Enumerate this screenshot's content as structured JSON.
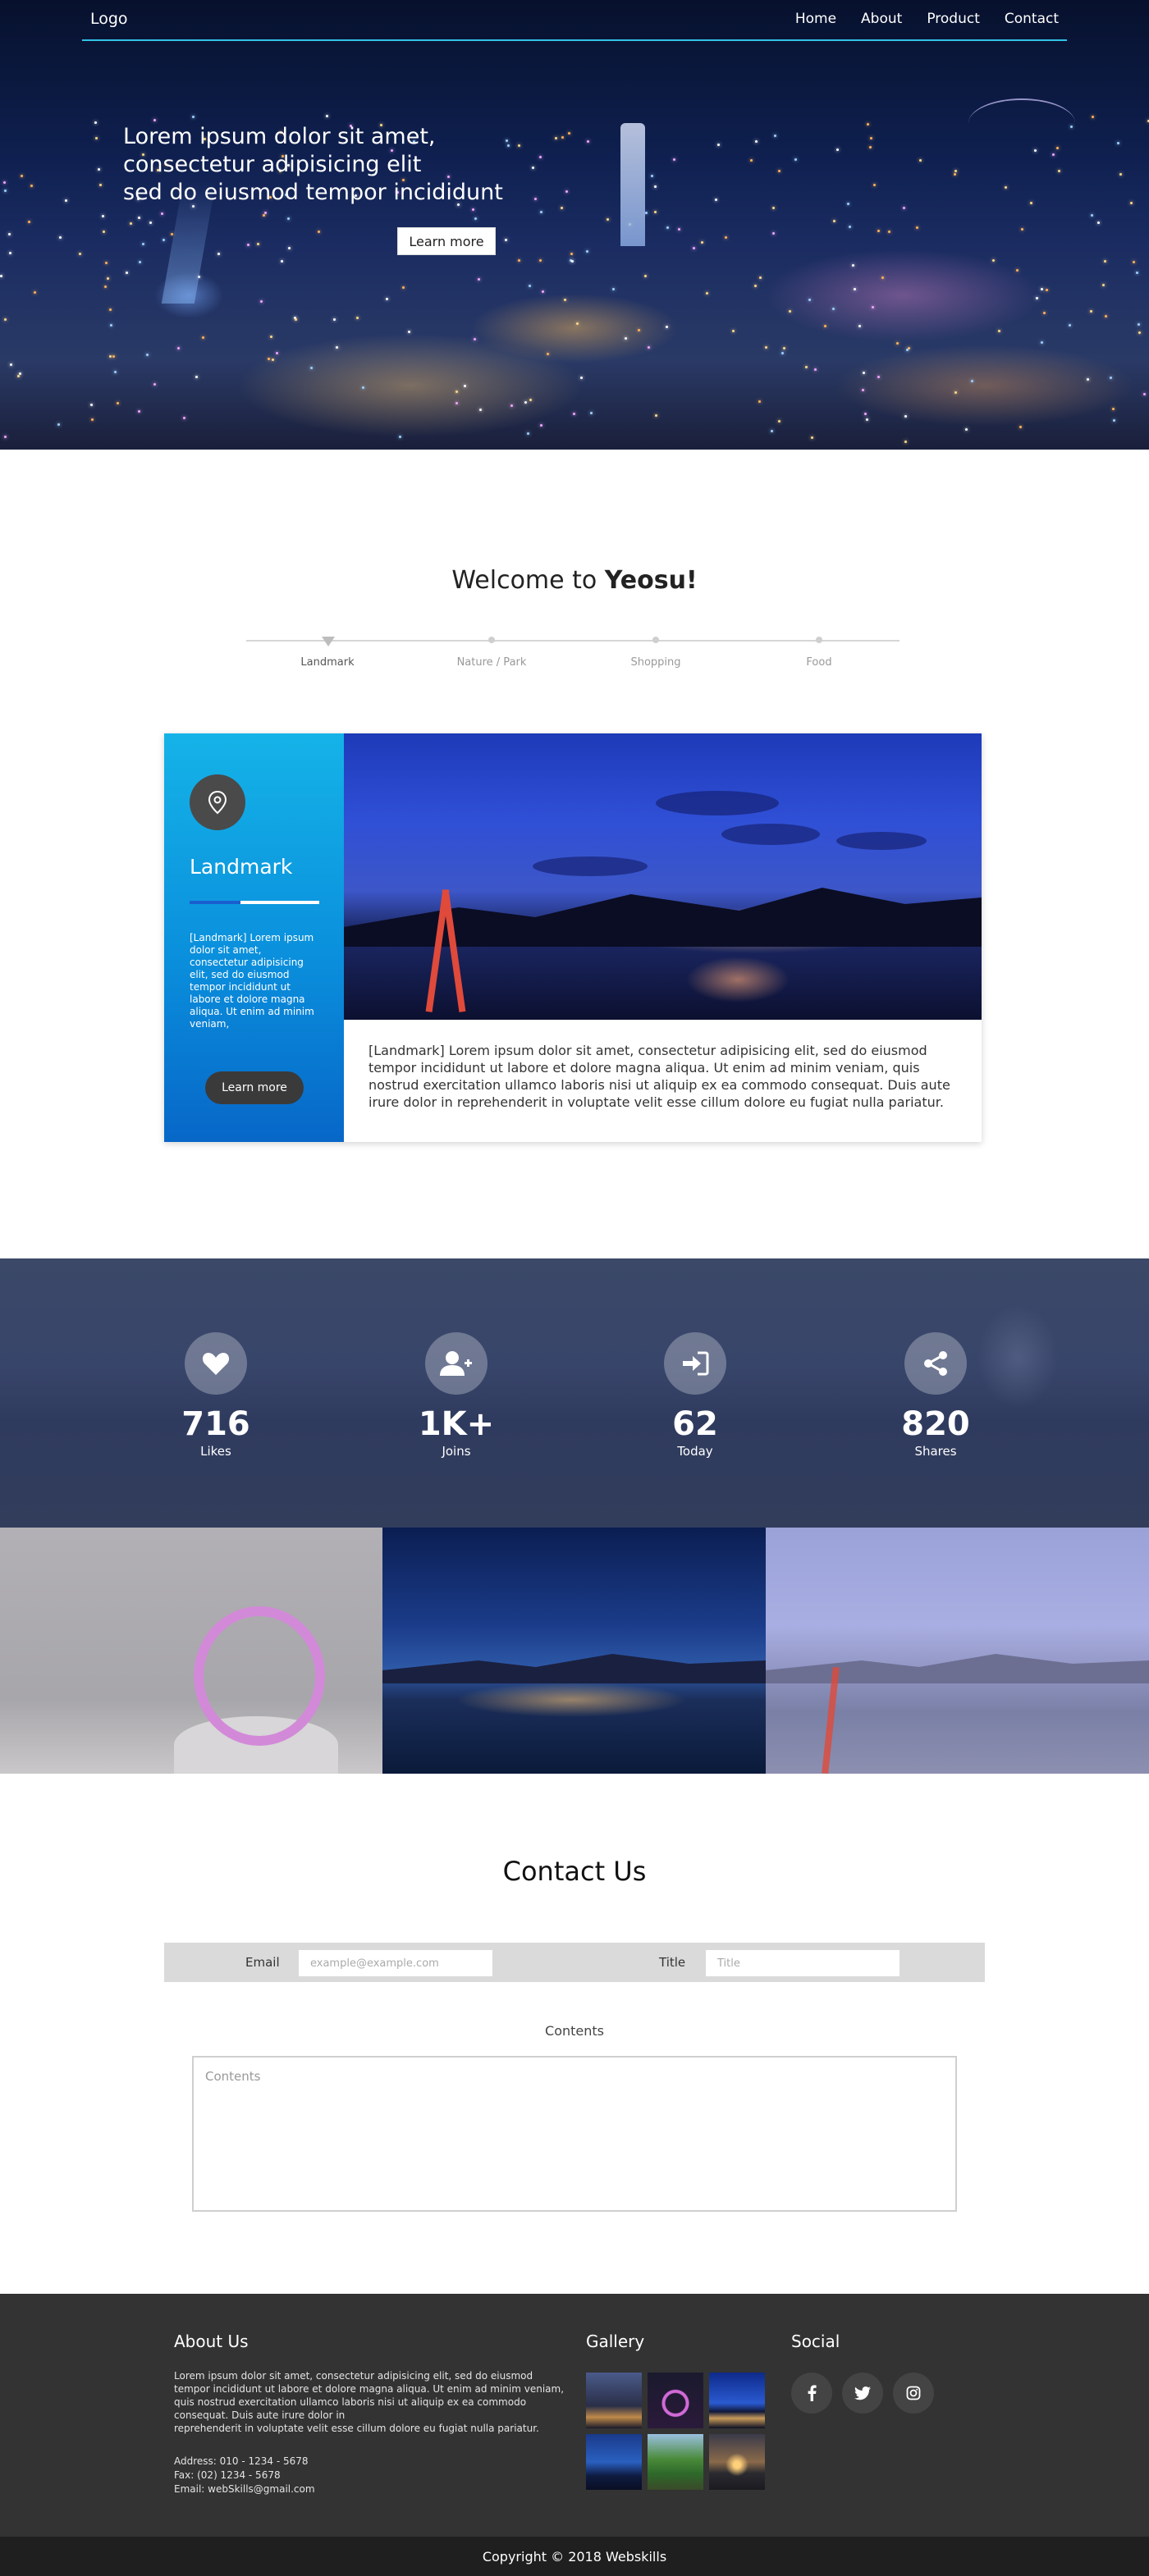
{
  "nav": {
    "logo": "Logo",
    "items": [
      "Home",
      "About",
      "Product",
      "Contact"
    ]
  },
  "hero": {
    "lines": [
      "Lorem ipsum dolor sit amet,",
      "consectetur adipisicing elit",
      "sed do eiusmod tempor incididunt"
    ],
    "button": "Learn more"
  },
  "welcome": {
    "prefix": "Welcome to ",
    "highlight": "Yeosu!",
    "tabs": [
      "Landmark",
      "Nature / Park",
      "Shopping",
      "Food"
    ],
    "active_tab": "Landmark"
  },
  "landmark": {
    "icon": "map-pin-icon",
    "title": "Landmark",
    "summary": "[Landmark] Lorem ipsum dolor sit amet, consectetur adipisicing elit, sed do eiusmod tempor incididunt ut labore et dolore magna aliqua. Ut enim ad minim veniam,",
    "button": "Learn more",
    "caption": "[Landmark] Lorem ipsum dolor sit amet, consectetur adipisicing elit, sed do eiusmod tempor incididunt ut labore et dolore magna aliqua. Ut enim ad minim veniam, quis nostrud exercitation ullamco laboris nisi ut aliquip ex ea commodo consequat. Duis aute irure dolor in reprehenderit in voluptate velit esse cillum dolore eu fugiat nulla pariatur."
  },
  "stats": [
    {
      "icon": "heart-icon",
      "value": "716",
      "label": "Likes"
    },
    {
      "icon": "user-plus-icon",
      "value": "1K+",
      "label": "Joins"
    },
    {
      "icon": "sign-in-icon",
      "value": "62",
      "label": "Today"
    },
    {
      "icon": "share-icon",
      "value": "820",
      "label": "Shares"
    }
  ],
  "contact": {
    "title": "Contact Us",
    "email_label": "Email",
    "email_placeholder": "example@example.com",
    "title_label": "Title",
    "title_placeholder": "Title",
    "contents_label": "Contents",
    "contents_placeholder": "Contents"
  },
  "footer": {
    "about_title": "About Us",
    "about_text_1": "Lorem ipsum dolor sit amet, consectetur adipisicing elit, sed do eiusmod tempor incididunt ut labore et dolore magna aliqua. Ut enim ad minim veniam, quis nostrud exercitation ullamco laboris nisi ut aliquip ex ea commodo consequat. Duis aute irure dolor in",
    "about_text_2": "reprehenderit in voluptate velit esse cillum dolore eu fugiat nulla pariatur.",
    "address": "Address: 010 - 1234 - 5678",
    "fax": "Fax: (02) 1234 - 5678",
    "email": "Email: webSkills@gmail.com",
    "gallery_title": "Gallery",
    "social_title": "Social",
    "socials": [
      "facebook-icon",
      "twitter-icon",
      "instagram-icon"
    ],
    "copyright": "Copyright © 2018 Webskills"
  },
  "colors": {
    "accent_line": "#31c3e6",
    "card_gradient_top": "#15b3e8",
    "card_gradient_bottom": "#0767c8",
    "stats_bg": "#38456a",
    "footer_bg": "#333333",
    "copyright_bg": "#1f1f1f"
  }
}
